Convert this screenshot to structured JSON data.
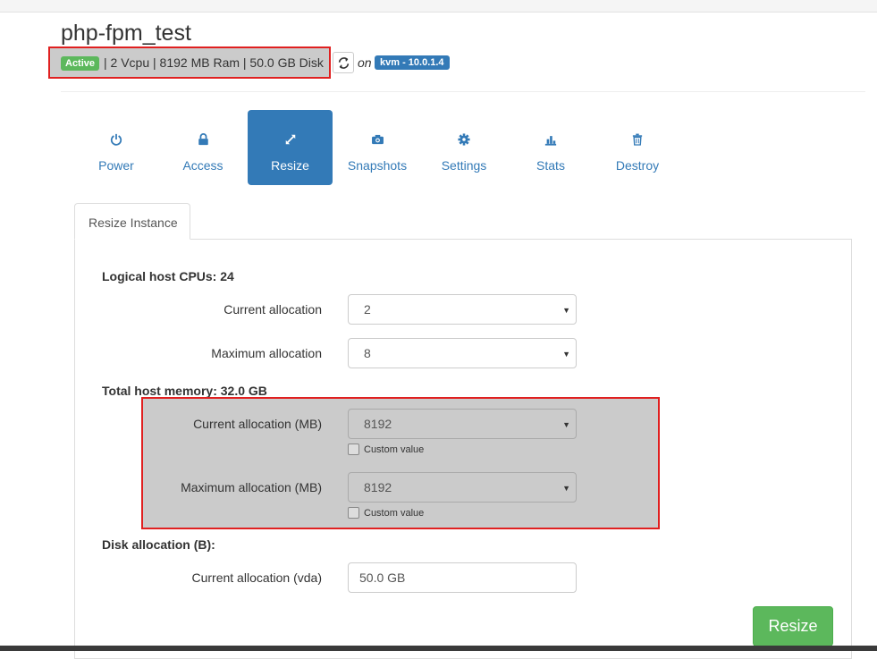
{
  "instance": {
    "name": "php-fpm_test",
    "status": "Active",
    "specs": "| 2 Vcpu | 8192 MB Ram | 50.0 GB Disk",
    "on_label": "on",
    "host": "kvm - 10.0.1.4"
  },
  "nav": [
    {
      "label": "Power",
      "icon": "power-icon"
    },
    {
      "label": "Access",
      "icon": "lock-icon"
    },
    {
      "label": "Resize",
      "icon": "resize-icon",
      "active": true
    },
    {
      "label": "Snapshots",
      "icon": "camera-icon"
    },
    {
      "label": "Settings",
      "icon": "gear-icon"
    },
    {
      "label": "Stats",
      "icon": "bar-chart-icon"
    },
    {
      "label": "Destroy",
      "icon": "trash-icon"
    }
  ],
  "tab": {
    "label": "Resize Instance"
  },
  "cpu": {
    "heading": "Logical host CPUs: 24",
    "current_label": "Current allocation",
    "current_value": "2",
    "max_label": "Maximum allocation",
    "max_value": "8"
  },
  "memory": {
    "heading": "Total host memory: 32.0 GB",
    "current_label": "Current allocation (MB)",
    "current_value": "8192",
    "max_label": "Maximum allocation (MB)",
    "max_value": "8192",
    "custom_label": "Custom value"
  },
  "disk": {
    "heading": "Disk allocation (B):",
    "current_label": "Current allocation (vda)",
    "current_value": "50.0 GB"
  },
  "actions": {
    "resize_label": "Resize"
  },
  "colors": {
    "primary": "#337ab7",
    "success": "#5cb85c",
    "highlight_border": "#e02020"
  }
}
